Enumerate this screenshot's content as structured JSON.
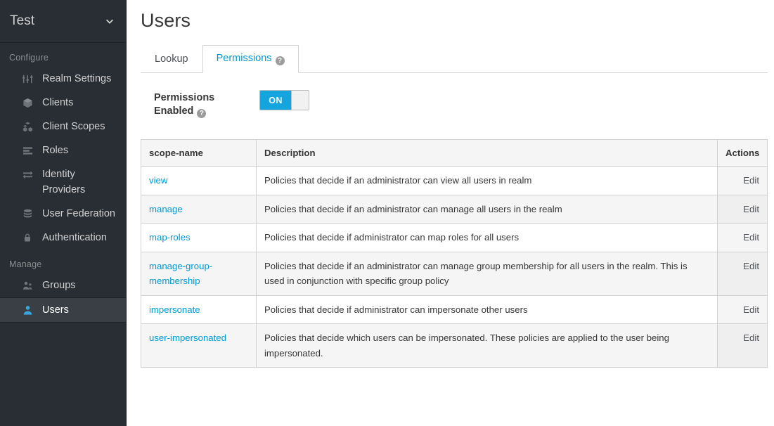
{
  "sidebar": {
    "realm": {
      "name": "Test",
      "chevron_icon": "chevron-down-icon"
    },
    "sections": [
      {
        "label": "Configure",
        "items": [
          {
            "label": "Realm Settings",
            "icon": "sliders-icon",
            "active": false
          },
          {
            "label": "Clients",
            "icon": "cube-icon",
            "active": false
          },
          {
            "label": "Client Scopes",
            "icon": "cubes-icon",
            "active": false
          },
          {
            "label": "Roles",
            "icon": "list-icon",
            "active": false
          },
          {
            "label": "Identity Providers",
            "icon": "exchange-icon",
            "active": false
          },
          {
            "label": "User Federation",
            "icon": "database-icon",
            "active": false
          },
          {
            "label": "Authentication",
            "icon": "lock-icon",
            "active": false
          }
        ]
      },
      {
        "label": "Manage",
        "items": [
          {
            "label": "Groups",
            "icon": "users-group-icon",
            "active": false
          },
          {
            "label": "Users",
            "icon": "user-icon",
            "active": true
          }
        ]
      }
    ]
  },
  "main": {
    "page_title": "Users",
    "tabs": [
      {
        "label": "Lookup",
        "active": false,
        "help": false
      },
      {
        "label": "Permissions",
        "active": true,
        "help": true,
        "help_glyph": "?"
      }
    ],
    "permissions_enabled": {
      "label": "Permissions Enabled",
      "help_glyph": "?",
      "toggle_on_label": "ON",
      "value": "ON"
    },
    "table": {
      "columns": [
        "scope-name",
        "Description",
        "Actions"
      ],
      "rows": [
        {
          "scope": "view",
          "description": "Policies that decide if an administrator can view all users in realm",
          "action": "Edit"
        },
        {
          "scope": "manage",
          "description": "Policies that decide if an administrator can manage all users in the realm",
          "action": "Edit"
        },
        {
          "scope": "map-roles",
          "description": "Policies that decide if administrator can map roles for all users",
          "action": "Edit"
        },
        {
          "scope": "manage-group-membership",
          "description": "Policies that decide if an administrator can manage group membership for all users in the realm. This is used in conjunction with specific group policy",
          "action": "Edit"
        },
        {
          "scope": "impersonate",
          "description": "Policies that decide if administrator can impersonate other users",
          "action": "Edit"
        },
        {
          "scope": "user-impersonated",
          "description": "Policies that decide which users can be impersonated. These policies are applied to the user being impersonated.",
          "action": "Edit"
        }
      ]
    }
  },
  "colors": {
    "sidebar_bg": "#292e34",
    "sidebar_active_bg": "#393f44",
    "accent_blue": "#0099d3",
    "toggle_blue": "#14a5de",
    "link_blue": "#0099d3",
    "table_stripe": "#f5f5f5",
    "border": "#d1d1d1"
  }
}
